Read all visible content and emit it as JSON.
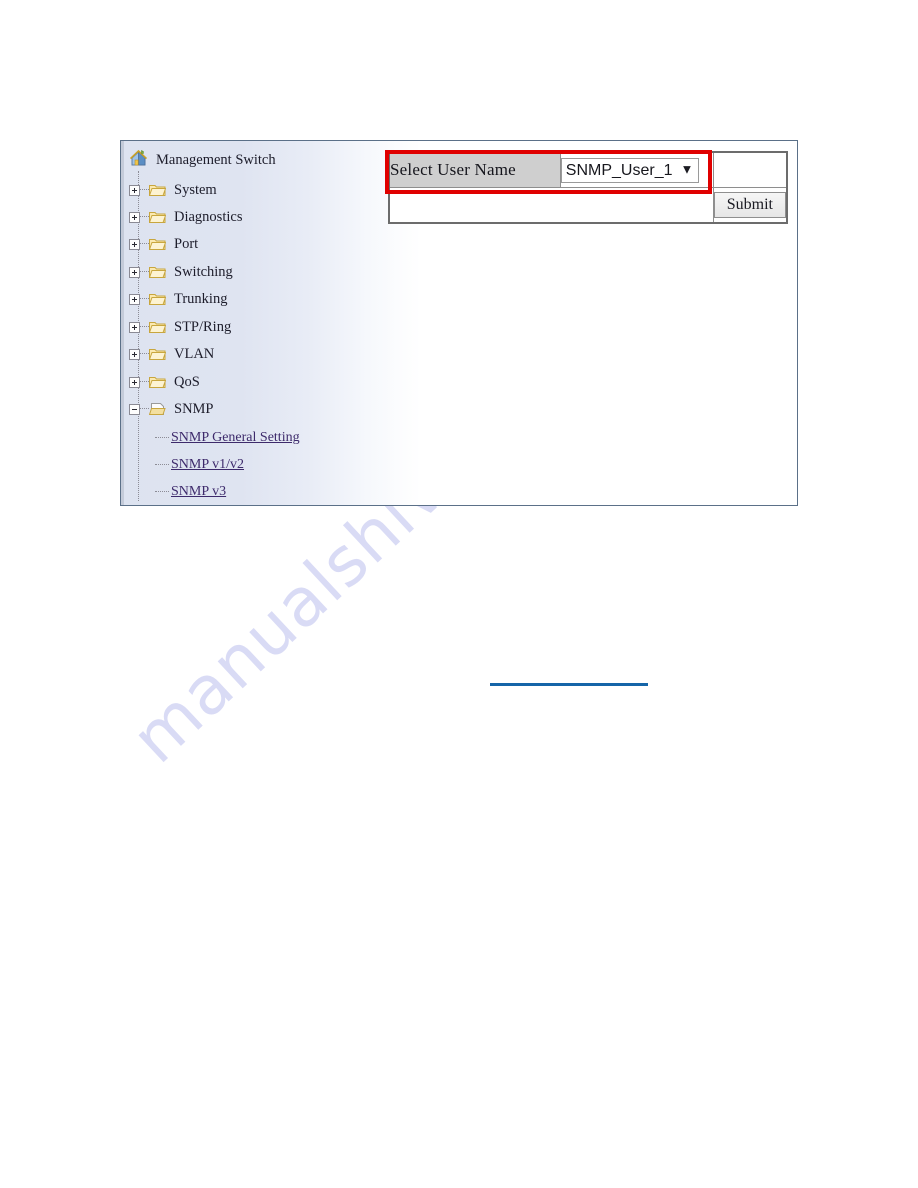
{
  "page": {
    "background_color": "#ffffff",
    "watermark_text": "manualshive.com",
    "watermark_color": "#d9dbf5"
  },
  "screenshot": {
    "frame_border_color": "#5b7088",
    "highlight_color": "#e00000",
    "link_rule_color": "#1565a8"
  },
  "tree": {
    "root": {
      "label": "Management Switch",
      "icon": "house-icon"
    },
    "nodes": [
      {
        "label": "System",
        "state": "collapsed",
        "icon": "folder-icon"
      },
      {
        "label": "Diagnostics",
        "state": "collapsed",
        "icon": "folder-icon"
      },
      {
        "label": "Port",
        "state": "collapsed",
        "icon": "folder-icon"
      },
      {
        "label": "Switching",
        "state": "collapsed",
        "icon": "folder-icon"
      },
      {
        "label": "Trunking",
        "state": "collapsed",
        "icon": "folder-icon"
      },
      {
        "label": "STP/Ring",
        "state": "collapsed",
        "icon": "folder-icon"
      },
      {
        "label": "VLAN",
        "state": "collapsed",
        "icon": "folder-icon"
      },
      {
        "label": "QoS",
        "state": "collapsed",
        "icon": "folder-icon"
      },
      {
        "label": "SNMP",
        "state": "expanded",
        "icon": "open-folder-icon"
      }
    ],
    "leaves": [
      {
        "label": "SNMP General Setting"
      },
      {
        "label": "SNMP v1/v2"
      },
      {
        "label": "SNMP v3"
      }
    ],
    "link_color": "#3d2a6b"
  },
  "form": {
    "row_label": "Select User Name",
    "select": {
      "selected": "SNMP_User_1",
      "options": [
        "SNMP_User_1"
      ],
      "caret_icon": "chevron-down-icon"
    },
    "submit_label": "Submit"
  }
}
